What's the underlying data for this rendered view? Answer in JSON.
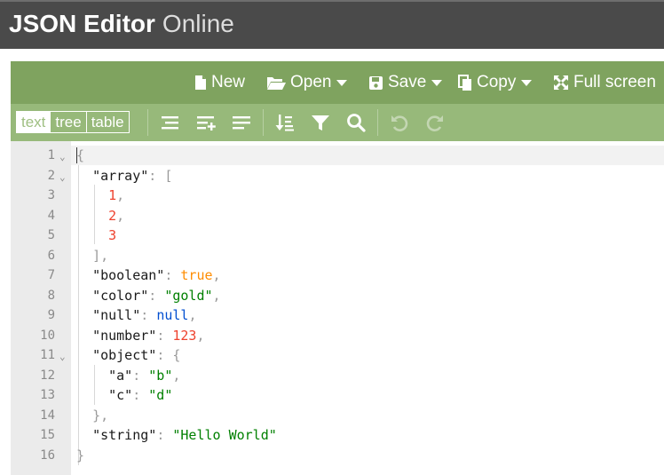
{
  "app": {
    "title_bold": "JSON Editor",
    "title_light": "Online"
  },
  "menu": {
    "new_label": "New",
    "open_label": "Open",
    "save_label": "Save",
    "copy_label": "Copy",
    "fullscreen_label": "Full screen"
  },
  "modes": {
    "text": "text",
    "tree": "tree",
    "table": "table",
    "active": "text"
  },
  "toolbar_icons": [
    "format-icon",
    "compact-icon",
    "repair-icon",
    "sort-icon",
    "filter-icon",
    "search-icon",
    "undo-icon",
    "redo-icon"
  ],
  "colors": {
    "header": "#4a4a4a",
    "menubar": "#7fa35f",
    "toolbar": "#97b97a",
    "number": "#ee422e",
    "boolean": "#ff8c00",
    "string": "#008000",
    "null": "#004ed0"
  },
  "editor": {
    "lines": [
      {
        "n": "1",
        "fold": true,
        "tokens": [
          {
            "t": "punc",
            "v": "{"
          }
        ]
      },
      {
        "n": "2",
        "fold": true,
        "tokens": [
          {
            "t": "ws",
            "v": "  "
          },
          {
            "t": "key",
            "v": "\"array\""
          },
          {
            "t": "punc",
            "v": ": ["
          }
        ]
      },
      {
        "n": "3",
        "fold": false,
        "tokens": [
          {
            "t": "ws",
            "v": "    "
          },
          {
            "t": "num",
            "v": "1"
          },
          {
            "t": "punc",
            "v": ","
          }
        ]
      },
      {
        "n": "4",
        "fold": false,
        "tokens": [
          {
            "t": "ws",
            "v": "    "
          },
          {
            "t": "num",
            "v": "2"
          },
          {
            "t": "punc",
            "v": ","
          }
        ]
      },
      {
        "n": "5",
        "fold": false,
        "tokens": [
          {
            "t": "ws",
            "v": "    "
          },
          {
            "t": "num",
            "v": "3"
          }
        ]
      },
      {
        "n": "6",
        "fold": false,
        "tokens": [
          {
            "t": "ws",
            "v": "  "
          },
          {
            "t": "punc",
            "v": "],"
          }
        ]
      },
      {
        "n": "7",
        "fold": false,
        "tokens": [
          {
            "t": "ws",
            "v": "  "
          },
          {
            "t": "key",
            "v": "\"boolean\""
          },
          {
            "t": "punc",
            "v": ": "
          },
          {
            "t": "bool",
            "v": "true"
          },
          {
            "t": "punc",
            "v": ","
          }
        ]
      },
      {
        "n": "8",
        "fold": false,
        "tokens": [
          {
            "t": "ws",
            "v": "  "
          },
          {
            "t": "key",
            "v": "\"color\""
          },
          {
            "t": "punc",
            "v": ": "
          },
          {
            "t": "str",
            "v": "\"gold\""
          },
          {
            "t": "punc",
            "v": ","
          }
        ]
      },
      {
        "n": "9",
        "fold": false,
        "tokens": [
          {
            "t": "ws",
            "v": "  "
          },
          {
            "t": "key",
            "v": "\"null\""
          },
          {
            "t": "punc",
            "v": ": "
          },
          {
            "t": "null",
            "v": "null"
          },
          {
            "t": "punc",
            "v": ","
          }
        ]
      },
      {
        "n": "10",
        "fold": false,
        "tokens": [
          {
            "t": "ws",
            "v": "  "
          },
          {
            "t": "key",
            "v": "\"number\""
          },
          {
            "t": "punc",
            "v": ": "
          },
          {
            "t": "num",
            "v": "123"
          },
          {
            "t": "punc",
            "v": ","
          }
        ]
      },
      {
        "n": "11",
        "fold": true,
        "tokens": [
          {
            "t": "ws",
            "v": "  "
          },
          {
            "t": "key",
            "v": "\"object\""
          },
          {
            "t": "punc",
            "v": ": {"
          }
        ]
      },
      {
        "n": "12",
        "fold": false,
        "tokens": [
          {
            "t": "ws",
            "v": "    "
          },
          {
            "t": "key",
            "v": "\"a\""
          },
          {
            "t": "punc",
            "v": ": "
          },
          {
            "t": "str",
            "v": "\"b\""
          },
          {
            "t": "punc",
            "v": ","
          }
        ]
      },
      {
        "n": "13",
        "fold": false,
        "tokens": [
          {
            "t": "ws",
            "v": "    "
          },
          {
            "t": "key",
            "v": "\"c\""
          },
          {
            "t": "punc",
            "v": ": "
          },
          {
            "t": "str",
            "v": "\"d\""
          }
        ]
      },
      {
        "n": "14",
        "fold": false,
        "tokens": [
          {
            "t": "ws",
            "v": "  "
          },
          {
            "t": "punc",
            "v": "},"
          }
        ]
      },
      {
        "n": "15",
        "fold": false,
        "tokens": [
          {
            "t": "ws",
            "v": "  "
          },
          {
            "t": "key",
            "v": "\"string\""
          },
          {
            "t": "punc",
            "v": ": "
          },
          {
            "t": "str",
            "v": "\"Hello World\""
          }
        ]
      },
      {
        "n": "16",
        "fold": false,
        "tokens": [
          {
            "t": "punc",
            "v": "}"
          }
        ]
      }
    ]
  }
}
